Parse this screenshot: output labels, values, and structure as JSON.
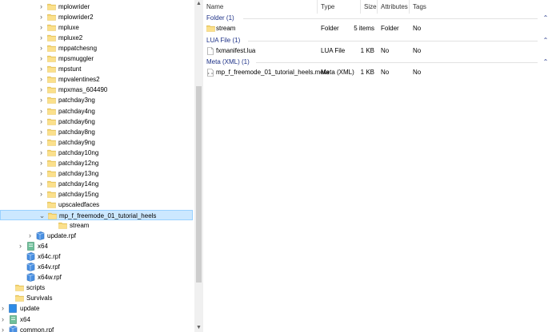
{
  "tree": {
    "items": [
      {
        "label": "mplowrider",
        "depth": 2,
        "icon": "folder-icon",
        "expandable": true
      },
      {
        "label": "mplowrider2",
        "depth": 2,
        "icon": "folder-icon",
        "expandable": true
      },
      {
        "label": "mpluxe",
        "depth": 2,
        "icon": "folder-icon",
        "expandable": true
      },
      {
        "label": "mpluxe2",
        "depth": 2,
        "icon": "folder-icon",
        "expandable": true
      },
      {
        "label": "mppatchesng",
        "depth": 2,
        "icon": "folder-icon",
        "expandable": true
      },
      {
        "label": "mpsmuggler",
        "depth": 2,
        "icon": "folder-icon",
        "expandable": true
      },
      {
        "label": "mpstunt",
        "depth": 2,
        "icon": "folder-icon",
        "expandable": true
      },
      {
        "label": "mpvalentines2",
        "depth": 2,
        "icon": "folder-icon",
        "expandable": true
      },
      {
        "label": "mpxmas_604490",
        "depth": 2,
        "icon": "folder-icon",
        "expandable": true
      },
      {
        "label": "patchday3ng",
        "depth": 2,
        "icon": "folder-icon",
        "expandable": true
      },
      {
        "label": "patchday4ng",
        "depth": 2,
        "icon": "folder-icon",
        "expandable": true
      },
      {
        "label": "patchday6ng",
        "depth": 2,
        "icon": "folder-icon",
        "expandable": true
      },
      {
        "label": "patchday8ng",
        "depth": 2,
        "icon": "folder-icon",
        "expandable": true
      },
      {
        "label": "patchday9ng",
        "depth": 2,
        "icon": "folder-icon",
        "expandable": true
      },
      {
        "label": "patchday10ng",
        "depth": 2,
        "icon": "folder-icon",
        "expandable": true
      },
      {
        "label": "patchday12ng",
        "depth": 2,
        "icon": "folder-icon",
        "expandable": true
      },
      {
        "label": "patchday13ng",
        "depth": 2,
        "icon": "folder-icon",
        "expandable": true
      },
      {
        "label": "patchday14ng",
        "depth": 2,
        "icon": "folder-icon",
        "expandable": true
      },
      {
        "label": "patchday15ng",
        "depth": 2,
        "icon": "folder-icon",
        "expandable": true
      },
      {
        "label": "upscaledfaces",
        "depth": 2,
        "icon": "folder-icon",
        "expandable": false
      },
      {
        "label": "mp_f_freemode_01_tutorial_heels",
        "depth": 2,
        "icon": "folder-icon",
        "expandable": true,
        "expanded": true,
        "selected": true
      },
      {
        "label": "stream",
        "depth": 3,
        "icon": "folder-icon",
        "expandable": false
      },
      {
        "label": "update.rpf",
        "depth": 1,
        "icon": "rpf-archive-icon",
        "expandable": true
      },
      {
        "label": "x64",
        "depth": 0,
        "icon": "x64-archive-icon",
        "expandable": true
      },
      {
        "label": "x64c.rpf",
        "depth": 0,
        "icon": "rpf-archive-icon",
        "expandable": false
      },
      {
        "label": "x64v.rpf",
        "depth": 0,
        "icon": "rpf-archive-icon",
        "expandable": false
      },
      {
        "label": "x64w.rpf",
        "depth": 0,
        "icon": "rpf-archive-icon",
        "expandable": false
      },
      {
        "label": "scripts",
        "depth": -1,
        "icon": "folder-icon",
        "expandable": false
      },
      {
        "label": "Survivals",
        "depth": -1,
        "icon": "folder-icon",
        "expandable": false
      },
      {
        "label": "update",
        "depth": -2,
        "icon": "drive-folder-icon",
        "expandable": true
      },
      {
        "label": "x64",
        "depth": -2,
        "icon": "x64-archive-icon",
        "expandable": true
      },
      {
        "label": "common.rpf",
        "depth": -2,
        "icon": "rpf-archive-icon",
        "expandable": true
      }
    ]
  },
  "columns": {
    "name": "Name",
    "type": "Type",
    "size": "Size",
    "attributes": "Attributes",
    "tags": "Tags"
  },
  "groups": [
    {
      "title": "Folder (1)",
      "files": [
        {
          "name": "stream",
          "icon": "folder-icon",
          "type": "Folder",
          "size": "5 items",
          "attributes": "Folder",
          "tags": "No"
        }
      ]
    },
    {
      "title": "LUA File (1)",
      "files": [
        {
          "name": "fxmanifest.lua",
          "icon": "document-icon",
          "type": "LUA File",
          "size": "1 KB",
          "attributes": "No",
          "tags": "No"
        }
      ]
    },
    {
      "title": "Meta (XML) (1)",
      "files": [
        {
          "name": "mp_f_freemode_01_tutorial_heels.meta",
          "icon": "xml-document-icon",
          "type": "Meta (XML)",
          "size": "1 KB",
          "attributes": "No",
          "tags": "No"
        }
      ]
    }
  ],
  "scrollbar": {
    "up": "▲",
    "down": "▼"
  },
  "glyphs": {
    "chevron_right": "›",
    "chevron_down": "⌄",
    "group_collapse": "⌃"
  },
  "colors": {
    "selection_bg": "#cce8ff",
    "selection_border": "#99d1ff",
    "group_header": "#1e3287",
    "folder": "#f7d774"
  }
}
